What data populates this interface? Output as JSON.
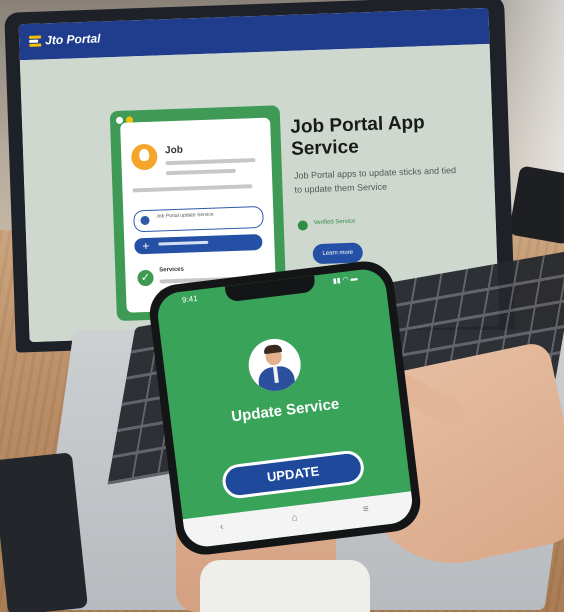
{
  "laptop_screen": {
    "logo_text": "Jto Portal",
    "hero_title": "Job Portal App Service",
    "hero_subtitle": "Job Portal apps to update sticks and tied to update them Service",
    "hero_check_text": "Verified Service",
    "hero_button": "Learn more",
    "doc_card": {
      "title": "Job",
      "field_text": "Job Portal update Service",
      "check_label": "Services"
    }
  },
  "phone": {
    "status_time": "9:41",
    "status_icons": "▮▮ ◠ ▬",
    "title": "Update Service",
    "button_label": "UPDATE",
    "nav_back_icon": "back-icon",
    "nav_home_icon": "home-icon",
    "nav_menu_icon": "menu-icon"
  },
  "colors": {
    "phone_green": "#3aa35a",
    "brand_blue": "#1f4a9c",
    "header_blue": "#1f3d8c",
    "card_green": "#3f9a55"
  }
}
